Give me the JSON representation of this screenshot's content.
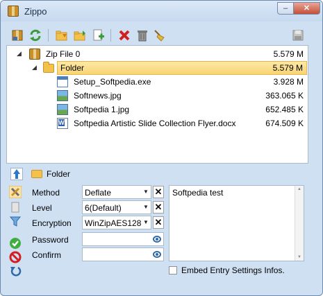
{
  "window": {
    "title": "Zippo",
    "minimize_glyph": "–",
    "close_glyph": "✕"
  },
  "toolbar": {
    "buttons": [
      {
        "name": "save-archive-icon",
        "color": "#c9902e"
      },
      {
        "name": "refresh-icon",
        "color": "#3a9b3a"
      },
      {
        "name": "add-folder-icon",
        "color": "#f2c24a"
      },
      {
        "name": "extract-icon",
        "color": "#f2c24a"
      },
      {
        "name": "new-file-icon",
        "color": "#5fb05f"
      },
      {
        "name": "delete-icon",
        "color": "#d21f1f"
      },
      {
        "name": "trash-icon",
        "color": "#808080"
      },
      {
        "name": "clean-icon",
        "color": "#e2b83a"
      },
      {
        "name": "save-disabled-icon",
        "color": "#b0b0b0"
      }
    ]
  },
  "tree": {
    "rows": [
      {
        "name": "Zip File 0",
        "size": "5.579 M",
        "type": "zip",
        "expander": "◢"
      },
      {
        "name": "Folder",
        "size": "5.579 M",
        "type": "folder",
        "expander": "◢",
        "selected": true
      },
      {
        "name": "Setup_Softpedia.exe",
        "size": "3.928 M",
        "type": "exe"
      },
      {
        "name": "Softnews.jpg",
        "size": "363.065 K",
        "type": "img"
      },
      {
        "name": "Softpedia 1.jpg",
        "size": "652.485 K",
        "type": "img"
      },
      {
        "name": "Softpedia Artistic Slide Collection Flyer.docx",
        "size": "674.509 K",
        "type": "doc"
      }
    ]
  },
  "path": {
    "label": "Folder"
  },
  "settings": {
    "method": {
      "label": "Method",
      "value": "Deflate"
    },
    "level": {
      "label": "Level",
      "value": "6(Default)"
    },
    "encryption": {
      "label": "Encryption",
      "value": "WinZipAES128"
    },
    "password": {
      "label": "Password",
      "value": ""
    },
    "confirm": {
      "label": "Confirm",
      "value": ""
    },
    "clear_glyph": "✕",
    "arrow_glyph": "▼"
  },
  "comment": {
    "text": "Softpedia test"
  },
  "embed": {
    "label": "Embed Entry Settings Infos.",
    "checked": false
  }
}
